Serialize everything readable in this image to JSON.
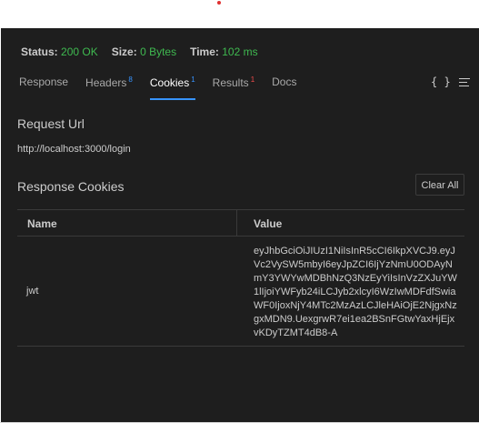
{
  "status": {
    "status_label": "Status:",
    "status_value": "200 OK",
    "size_label": "Size:",
    "size_value": "0 Bytes",
    "time_label": "Time:",
    "time_value": "102 ms"
  },
  "tabs": [
    {
      "label": "Response",
      "badge": ""
    },
    {
      "label": "Headers",
      "badge": "8"
    },
    {
      "label": "Cookies",
      "badge": "1"
    },
    {
      "label": "Results",
      "badge": "1"
    },
    {
      "label": "Docs",
      "badge": ""
    }
  ],
  "toolbar": {
    "braces_glyph": "{ }"
  },
  "request": {
    "label": "Request Url",
    "url": "http://localhost:3000/login"
  },
  "cookies": {
    "label": "Response Cookies",
    "clear_button": "Clear All",
    "columns": [
      "Name",
      "Value"
    ],
    "rows": [
      {
        "name": "jwt",
        "value": "eyJhbGciOiJIUzI1NiIsInR5cCI6IkpXVCJ9.eyJVc2VySW5mbyI6eyJpZCI6IjYzNmU0ODAyNmY3YWYwMDBhNzQ3NzEyYiIsInVzZXJuYW1lIjoiYWFyb24iLCJyb2xlcyI6WzIwMDFdfSwiaWF0IjoxNjY4MTc2MzAzLCJleHAiOjE2NjgxNzgxMDN9.UexgrwR7ei1ea2BSnFGtwYaxHjEjxvKDyTZMT4dB8-A"
      }
    ]
  },
  "colors": {
    "background": "#1e1e1e",
    "success": "#3fb950",
    "accent": "#3794ff",
    "error_badge": "#f14c4c"
  },
  "icons": [
    "braces-icon",
    "menu-icon"
  ]
}
